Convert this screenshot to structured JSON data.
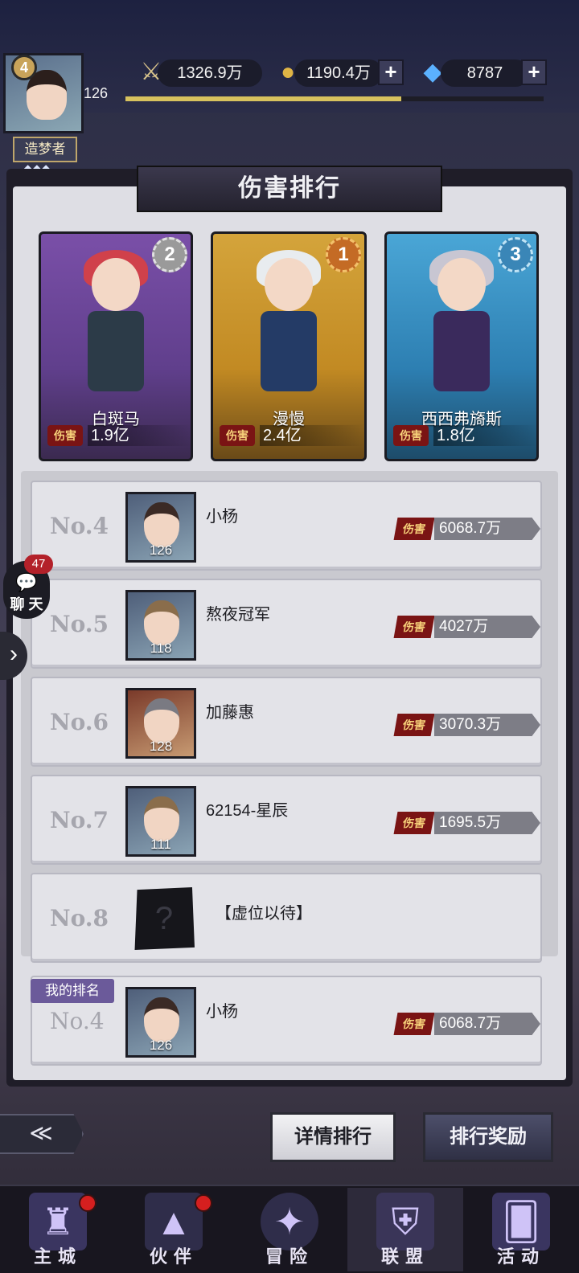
{
  "header": {
    "avatar_level": "4",
    "player_level": "126",
    "title_tag": "造梦者",
    "title_stars": "◆◆◆",
    "resources": [
      {
        "icon": "sword-icon",
        "value": "1326.9万"
      },
      {
        "icon": "gold-coin-icon",
        "value": "1190.4万"
      },
      {
        "icon": "diamond-icon",
        "value": "8787"
      }
    ],
    "plus_symbol": "+",
    "xp_fraction": 0.66
  },
  "banner_title": "伤害排行",
  "podium": [
    {
      "rank": "2",
      "name": "白斑马",
      "damage_label": "伤害",
      "damage": "1.9亿",
      "theme": "purple"
    },
    {
      "rank": "1",
      "name": "漫慢",
      "damage_label": "伤害",
      "damage": "2.4亿",
      "theme": "gold"
    },
    {
      "rank": "3",
      "name": "西西弗旖斯",
      "damage_label": "伤害",
      "damage": "1.8亿",
      "theme": "blue"
    }
  ],
  "ranks": [
    {
      "rank": "No.4",
      "name": "小杨",
      "level": "126",
      "damage_label": "伤害",
      "damage": "6068.7万"
    },
    {
      "rank": "No.5",
      "name": "熬夜冠军",
      "level": "118",
      "damage_label": "伤害",
      "damage": "4027万"
    },
    {
      "rank": "No.6",
      "name": "加藤惠",
      "level": "128",
      "damage_label": "伤害",
      "damage": "3070.3万"
    },
    {
      "rank": "No.7",
      "name": "62154-星辰",
      "level": "111",
      "damage_label": "伤害",
      "damage": "1695.5万"
    },
    {
      "rank": "No.8",
      "name": "【虚位以待】",
      "placeholder": "?"
    }
  ],
  "my_rank": {
    "tag": "我的排名",
    "rank": "No.4",
    "name": "小杨",
    "level": "126",
    "damage_label": "伤害",
    "damage": "6068.7万"
  },
  "chat": {
    "label": "聊 天",
    "count": "47"
  },
  "side_arrow": "›",
  "buttons": {
    "back": "≪",
    "details": "详情排行",
    "rewards": "排行奖励"
  },
  "nav": [
    {
      "label": "主城",
      "icon": "castle-icon",
      "dot": true
    },
    {
      "label": "伙伴",
      "icon": "witch-hat-icon",
      "dot": true
    },
    {
      "label": "冒险",
      "icon": "compass-icon",
      "dot": false
    },
    {
      "label": "联盟",
      "icon": "shield-icon",
      "dot": false,
      "active": true
    },
    {
      "label": "活动",
      "icon": "cards-icon",
      "dot": false
    }
  ]
}
